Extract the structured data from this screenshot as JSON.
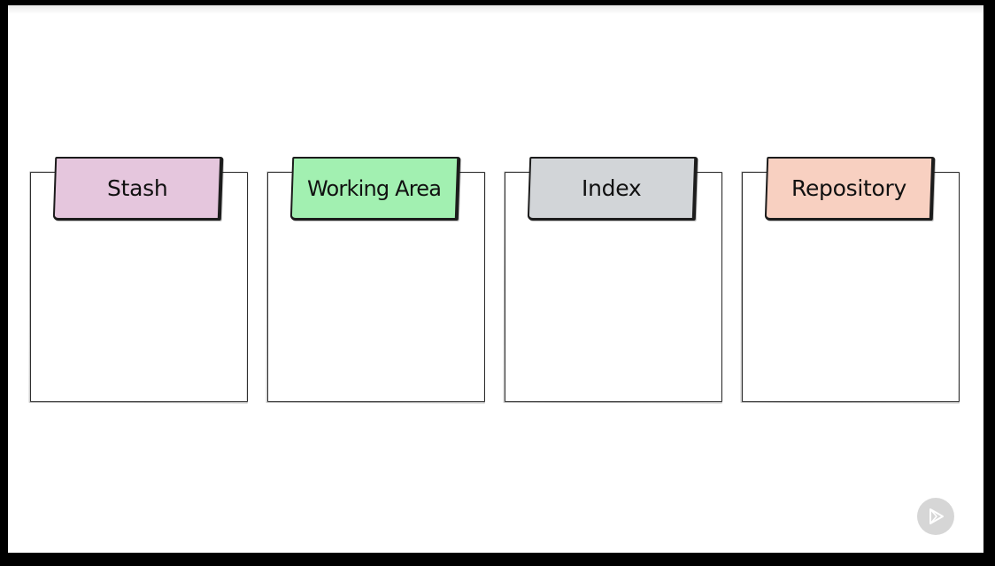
{
  "diagram": {
    "boxes": [
      {
        "id": "stash",
        "label": "Stash",
        "color": "#e5c6dd"
      },
      {
        "id": "working-area",
        "label": "Working Area",
        "color": "#a2f0b1"
      },
      {
        "id": "index",
        "label": "Index",
        "color": "#d2d5d8"
      },
      {
        "id": "repository",
        "label": "Repository",
        "color": "#f8d0c1"
      }
    ]
  },
  "controls": {
    "play_icon": "play-icon"
  }
}
